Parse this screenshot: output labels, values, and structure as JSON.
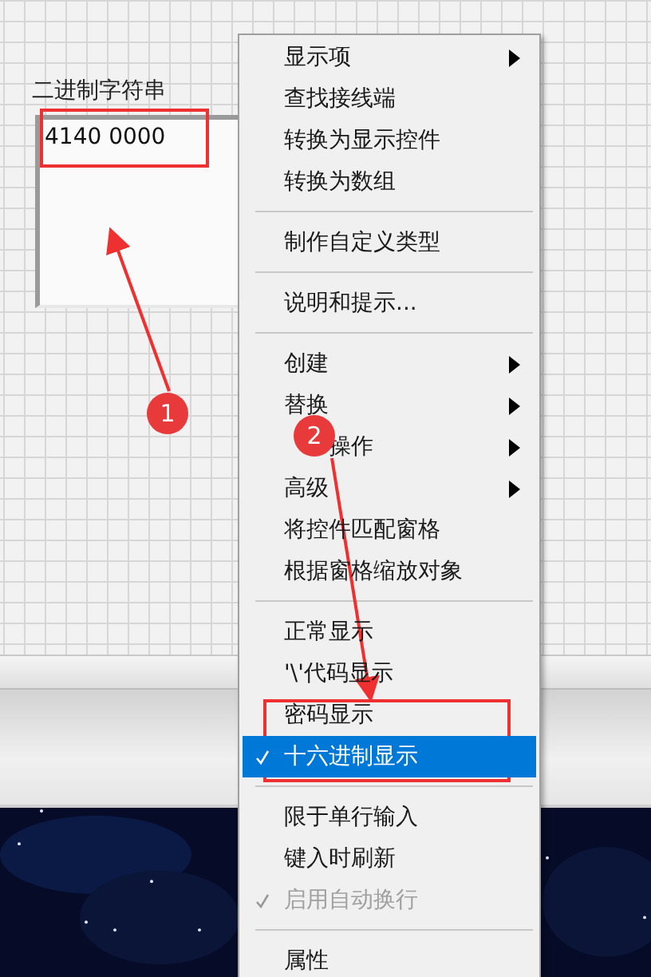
{
  "control": {
    "label": "二进制字符串",
    "value": "4140 0000"
  },
  "menu": {
    "items": [
      {
        "kind": "item",
        "label": "显示项",
        "has_submenu": true,
        "checked": false,
        "selected": false,
        "disabled": false
      },
      {
        "kind": "item",
        "label": "查找接线端",
        "has_submenu": false,
        "checked": false,
        "selected": false,
        "disabled": false
      },
      {
        "kind": "item",
        "label": "转换为显示控件",
        "has_submenu": false,
        "checked": false,
        "selected": false,
        "disabled": false
      },
      {
        "kind": "item",
        "label": "转换为数组",
        "has_submenu": false,
        "checked": false,
        "selected": false,
        "disabled": false
      },
      {
        "kind": "separator"
      },
      {
        "kind": "item",
        "label": "制作自定义类型",
        "has_submenu": false,
        "checked": false,
        "selected": false,
        "disabled": false
      },
      {
        "kind": "separator"
      },
      {
        "kind": "item",
        "label": "说明和提示...",
        "has_submenu": false,
        "checked": false,
        "selected": false,
        "disabled": false
      },
      {
        "kind": "separator"
      },
      {
        "kind": "item",
        "label": "创建",
        "has_submenu": true,
        "checked": false,
        "selected": false,
        "disabled": false
      },
      {
        "kind": "item",
        "label": "替换",
        "has_submenu": true,
        "checked": false,
        "selected": false,
        "disabled": false
      },
      {
        "kind": "item",
        "label": "操作",
        "has_submenu": true,
        "checked": false,
        "selected": false,
        "disabled": false,
        "partly_covered": true
      },
      {
        "kind": "item",
        "label": "高级",
        "has_submenu": true,
        "checked": false,
        "selected": false,
        "disabled": false
      },
      {
        "kind": "item",
        "label": "将控件匹配窗格",
        "has_submenu": false,
        "checked": false,
        "selected": false,
        "disabled": false
      },
      {
        "kind": "item",
        "label": "根据窗格缩放对象",
        "has_submenu": false,
        "checked": false,
        "selected": false,
        "disabled": false
      },
      {
        "kind": "separator"
      },
      {
        "kind": "item",
        "label": "正常显示",
        "has_submenu": false,
        "checked": false,
        "selected": false,
        "disabled": false
      },
      {
        "kind": "item",
        "label": "'\\'代码显示",
        "has_submenu": false,
        "checked": false,
        "selected": false,
        "disabled": false
      },
      {
        "kind": "item",
        "label": "密码显示",
        "has_submenu": false,
        "checked": false,
        "selected": false,
        "disabled": false
      },
      {
        "kind": "item",
        "label": "十六进制显示",
        "has_submenu": false,
        "checked": true,
        "selected": true,
        "disabled": false
      },
      {
        "kind": "separator"
      },
      {
        "kind": "item",
        "label": "限于单行输入",
        "has_submenu": false,
        "checked": false,
        "selected": false,
        "disabled": false
      },
      {
        "kind": "item",
        "label": "键入时刷新",
        "has_submenu": false,
        "checked": false,
        "selected": false,
        "disabled": false
      },
      {
        "kind": "item",
        "label": "启用自动换行",
        "has_submenu": false,
        "checked": true,
        "selected": false,
        "disabled": true
      },
      {
        "kind": "separator"
      },
      {
        "kind": "item",
        "label": "属性",
        "has_submenu": false,
        "checked": false,
        "selected": false,
        "disabled": false
      }
    ]
  },
  "annotations": [
    {
      "number": "1"
    },
    {
      "number": "2"
    }
  ]
}
